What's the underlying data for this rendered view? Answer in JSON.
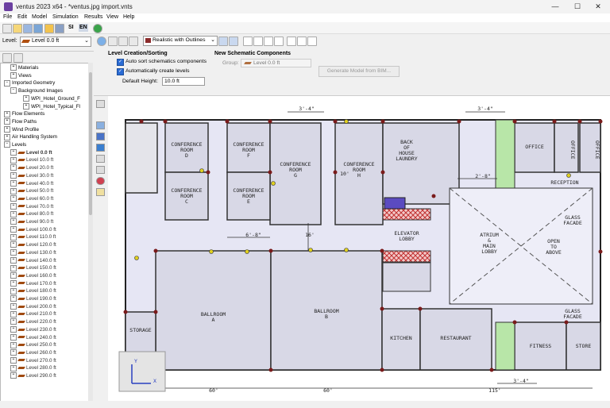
{
  "window": {
    "title": "ventus 2023 x64 - *ventus.jpg import.vnts",
    "minimize": "—",
    "maximize": "☐",
    "close": "✕"
  },
  "menu": [
    "File",
    "Edit",
    "Model",
    "Simulation",
    "Results",
    "View",
    "Help"
  ],
  "toolbar1": {
    "si_label": "SI",
    "en_label": "EN"
  },
  "level_selector": {
    "label": "Level:",
    "value": "Level 0.0 ft"
  },
  "tree": {
    "items": [
      {
        "label": "Materials",
        "indent": 1
      },
      {
        "label": "Views",
        "indent": 1
      },
      {
        "label": "Imported Geometry",
        "indent": 0
      },
      {
        "label": "Background Images",
        "indent": 1
      },
      {
        "label": "WPI_Hotel_Ground_F",
        "indent": 3
      },
      {
        "label": "WPI_Hotel_Typical_Fl",
        "indent": 3
      },
      {
        "label": "Flow Elements",
        "indent": 0
      },
      {
        "label": "Flow Paths",
        "indent": 0
      },
      {
        "label": "Wind Profile",
        "indent": 0
      },
      {
        "label": "Air Handling System",
        "indent": 0
      },
      {
        "label": "Levels",
        "indent": 0
      }
    ],
    "levels": [
      "Level 0.0 ft",
      "Level 10.0 ft",
      "Level 20.0 ft",
      "Level 30.0 ft",
      "Level 40.0 ft",
      "Level 50.0 ft",
      "Level 60.0 ft",
      "Level 70.0 ft",
      "Level 80.0 ft",
      "Level 90.0 ft",
      "Level 100.0 ft",
      "Level 110.0 ft",
      "Level 120.0 ft",
      "Level 130.0 ft",
      "Level 140.0 ft",
      "Level 150.0 ft",
      "Level 160.0 ft",
      "Level 170.0 ft",
      "Level 180.0 ft",
      "Level 190.0 ft",
      "Level 200.0 ft",
      "Level 210.0 ft",
      "Level 220.0 ft",
      "Level 230.0 ft",
      "Level 240.0 ft",
      "Level 250.0 ft",
      "Level 260.0 ft",
      "Level 270.0 ft",
      "Level 280.0 ft",
      "Level 290.0 ft"
    ]
  },
  "toolbar2": {
    "view_mode": "Realistic with Outlines"
  },
  "panel": {
    "level_creation": {
      "title": "Level Creation/Sorting",
      "auto_sort": "Auto sort schematics components",
      "auto_create": "Automatically create levels",
      "default_height_label": "Default Height:",
      "default_height_value": "10.0 ft"
    },
    "new_schematic": {
      "title": "New Schematic Components",
      "group_label": "Group:",
      "group_value": "Level 0.0 ft"
    },
    "generate_button": "Generate Model from BIM..."
  },
  "plan": {
    "rooms": [
      {
        "name": "CONFERENCE\nROOM\nD"
      },
      {
        "name": "CONFERENCE\nROOM\nF"
      },
      {
        "name": "CONFERENCE\nROOM\nG"
      },
      {
        "name": "CONFERENCE\nROOM\nH"
      },
      {
        "name": "BACK\nOF\nHOUSE\nLAUNDRY"
      },
      {
        "name": "OFFICE"
      },
      {
        "name": "OFFICE"
      },
      {
        "name": "OFFICE"
      },
      {
        "name": "CONFERENCE\nROOM\nC"
      },
      {
        "name": "CONFERENCE\nROOM\nE"
      },
      {
        "name": "RECEPTION"
      },
      {
        "name": "GLASS\nFACADE"
      },
      {
        "name": "ELEVATOR\nLOBBY"
      },
      {
        "name": "ATRIUM\n&\nMAIN\nLOBBY"
      },
      {
        "name": "OPEN\nTO\nABOVE"
      },
      {
        "name": "BALLROOM\nA"
      },
      {
        "name": "BALLROOM\nB"
      },
      {
        "name": "GLASS\nFACADE"
      },
      {
        "name": "STORAGE"
      },
      {
        "name": "KITCHEN"
      },
      {
        "name": "RESTAURANT"
      },
      {
        "name": "FITNESS"
      },
      {
        "name": "STORE"
      }
    ],
    "dimensions": [
      "3'-4\"",
      "3'-4\"",
      "2'-8\"",
      "10'",
      "6'-8\"",
      "16'",
      "3'-4\"",
      "60'",
      "60'",
      "115'"
    ],
    "axes": {
      "x": "X",
      "y": "Y"
    }
  }
}
